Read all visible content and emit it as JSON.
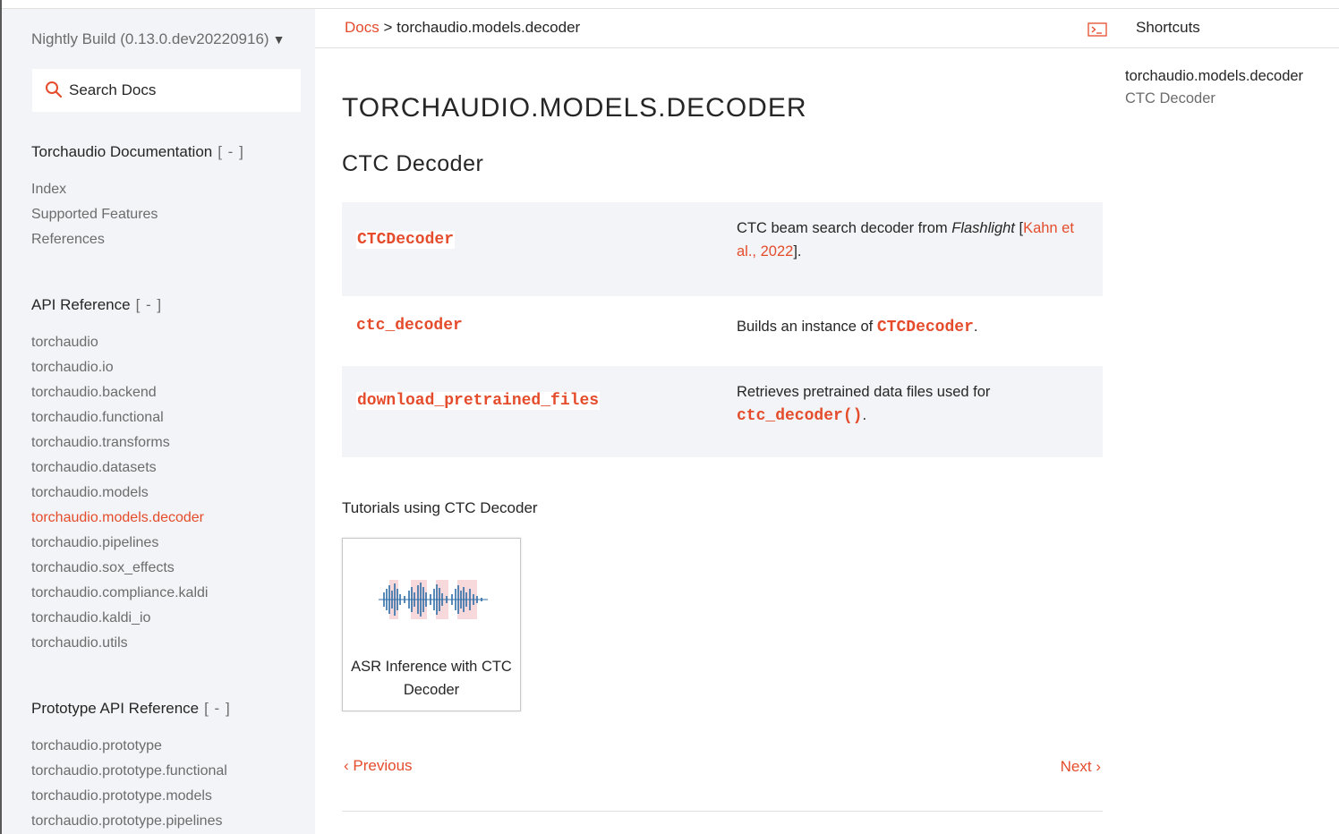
{
  "sidebar": {
    "version": "Nightly Build (0.13.0.dev20220916)",
    "version_toggle": "▼",
    "search_placeholder": "Search Docs",
    "sections": [
      {
        "title": "Torchaudio Documentation",
        "toggle": "[ - ]",
        "items": [
          "Index",
          "Supported Features",
          "References"
        ]
      },
      {
        "title": "API Reference",
        "toggle": "[ - ]",
        "items": [
          "torchaudio",
          "torchaudio.io",
          "torchaudio.backend",
          "torchaudio.functional",
          "torchaudio.transforms",
          "torchaudio.datasets",
          "torchaudio.models",
          "torchaudio.models.decoder",
          "torchaudio.pipelines",
          "torchaudio.sox_effects",
          "torchaudio.compliance.kaldi",
          "torchaudio.kaldi_io",
          "torchaudio.utils"
        ]
      },
      {
        "title": "Prototype API Reference",
        "toggle": "[ - ]",
        "items": [
          "torchaudio.prototype",
          "torchaudio.prototype.functional",
          "torchaudio.prototype.models",
          "torchaudio.prototype.pipelines"
        ]
      }
    ]
  },
  "breadcrumb": {
    "root": "Docs",
    "separator": ">",
    "current": "torchaudio.models.decoder"
  },
  "header": {
    "shortcuts_label": "Shortcuts"
  },
  "main": {
    "page_title": "TORCHAUDIO.MODELS.DECODER",
    "section_title": "CTC Decoder",
    "api_rows": [
      {
        "name": "CTCDecoder",
        "desc_pre": "CTC beam search decoder from ",
        "desc_em": "Flashlight",
        "desc_bracket_open": " [",
        "desc_ref_1": "Kahn et",
        "desc_ref_2": "al., 2022",
        "desc_bracket_close": "]."
      },
      {
        "name": "ctc_decoder",
        "desc_pre": "Builds an instance of ",
        "desc_code": "CTCDecoder",
        "desc_post": "."
      },
      {
        "name": "download_pretrained_files",
        "desc_pre": "Retrieves pretrained data files used for",
        "desc_code": "ctc_decoder()",
        "desc_post": "."
      }
    ],
    "tutorials_heading": "Tutorials using CTC Decoder",
    "tutorial_card": {
      "caption_line1": "ASR Inference with CTC",
      "caption_line2": "Decoder"
    },
    "prev_label": "Previous",
    "prev_chevron": "‹",
    "next_label": "Next",
    "next_chevron": "›"
  },
  "right_panel": {
    "items": [
      "torchaudio.models.decoder",
      "CTC Decoder"
    ]
  },
  "colors": {
    "accent": "#e44c2c",
    "sidebar_bg": "#f3f4f7",
    "text": "#262626",
    "muted": "#6c6c6d"
  }
}
